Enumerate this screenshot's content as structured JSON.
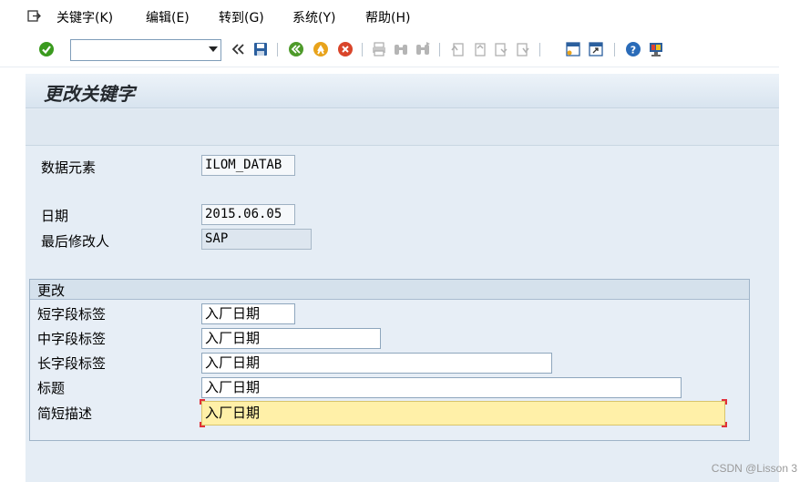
{
  "menu": {
    "items": [
      {
        "label": "关键字(K)"
      },
      {
        "label": "编辑(E)"
      },
      {
        "label": "转到(G)"
      },
      {
        "label": "系统(Y)"
      },
      {
        "label": "帮助(H)"
      }
    ]
  },
  "toolbar": {
    "command_field_value": "",
    "icons": [
      "enter-check",
      "back-arrows",
      "save",
      "back",
      "exit",
      "cancel",
      "print",
      "find",
      "find-next",
      "first-page",
      "previous-page",
      "next-page",
      "last-page",
      "new-session",
      "shortcut",
      "help",
      "customize-layout"
    ],
    "colors": {
      "check": "#3a9a1e",
      "back": "#4e9a2a",
      "exit": "#e8a31b",
      "cancel": "#d9452a",
      "help": "#2a6bb8"
    }
  },
  "screen": {
    "title": "更改关键字"
  },
  "fields": {
    "data_element": {
      "label": "数据元素",
      "value": "ILOM_DATAB"
    },
    "date": {
      "label": "日期",
      "value": "2015.06.05"
    },
    "last_changed_by": {
      "label": "最后修改人",
      "value": "SAP"
    }
  },
  "changes_group": {
    "title": "更改",
    "rows": [
      {
        "label": "短字段标签",
        "value": "入厂日期"
      },
      {
        "label": "中字段标签",
        "value": "入厂日期"
      },
      {
        "label": "长字段标签",
        "value": "入厂日期"
      },
      {
        "label": "标题",
        "value": "入厂日期"
      },
      {
        "label": "简短描述",
        "value": "入厂日期"
      }
    ]
  },
  "watermark": "CSDN @Lisson 3"
}
